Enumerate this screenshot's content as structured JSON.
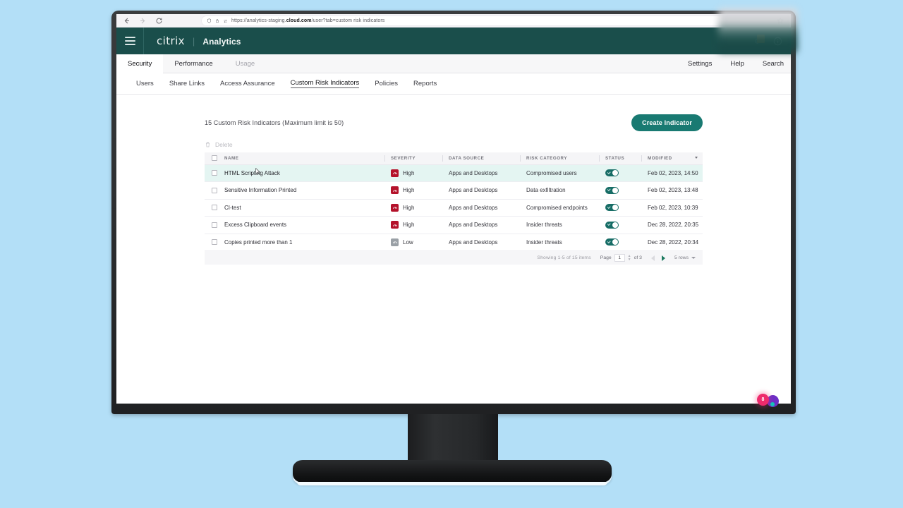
{
  "browser": {
    "url_prefix": "https://analytics-staging.",
    "url_domain": "cloud.com",
    "url_suffix": "/user?tab=custom risk indicators",
    "back_icon": "back-arrow-icon",
    "forward_icon": "forward-arrow-icon",
    "reload_icon": "reload-icon",
    "shield_icon": "shield-icon",
    "lock_icon": "lock-icon",
    "tracking_icon": "tracking-prevention-icon",
    "favorite_icon": "star-icon"
  },
  "app_header": {
    "menu_icon": "hamburger-menu-icon",
    "brand": "citrix",
    "separator": "|",
    "product": "Analytics",
    "notification_icon": "bell-icon",
    "help_icon": "info-circle-icon"
  },
  "primary_tabs": [
    {
      "label": "Security",
      "active": true,
      "muted": false
    },
    {
      "label": "Performance",
      "active": false,
      "muted": false
    },
    {
      "label": "Usage",
      "active": false,
      "muted": true
    }
  ],
  "primary_right": [
    {
      "label": "Settings"
    },
    {
      "label": "Help"
    },
    {
      "label": "Search"
    }
  ],
  "secondary_tabs": [
    {
      "label": "Users",
      "active": false
    },
    {
      "label": "Share Links",
      "active": false
    },
    {
      "label": "Access Assurance",
      "active": false
    },
    {
      "label": "Custom Risk Indicators",
      "active": true
    },
    {
      "label": "Policies",
      "active": false
    },
    {
      "label": "Reports",
      "active": false
    }
  ],
  "main": {
    "count_text": "15 Custom Risk Indicators (Maximum limit is 50)",
    "create_button": "Create Indicator",
    "delete_label": "Delete",
    "delete_icon": "trash-icon"
  },
  "table": {
    "columns": [
      "NAME",
      "SEVERITY",
      "DATA SOURCE",
      "RISK CATEGORY",
      "STATUS",
      "MODIFIED"
    ],
    "rows": [
      {
        "name": "HTML Scripting Attack",
        "severity": "High",
        "severity_level": "high",
        "data_source": "Apps and Desktops",
        "risk_category": "Compromised users",
        "status_on": true,
        "modified": "Feb 02, 2023, 14:50",
        "highlighted": true
      },
      {
        "name": "Sensitive Information Printed",
        "severity": "High",
        "severity_level": "high",
        "data_source": "Apps and Desktops",
        "risk_category": "Data exfiltration",
        "status_on": true,
        "modified": "Feb 02, 2023, 13:48",
        "highlighted": false
      },
      {
        "name": "CI-test",
        "severity": "High",
        "severity_level": "high",
        "data_source": "Apps and Desktops",
        "risk_category": "Compromised endpoints",
        "status_on": true,
        "modified": "Feb 02, 2023, 10:39",
        "highlighted": false
      },
      {
        "name": "Excess Clipboard events",
        "severity": "High",
        "severity_level": "high",
        "data_source": "Apps and Desktops",
        "risk_category": "Insider threats",
        "status_on": true,
        "modified": "Dec 28, 2022, 20:35",
        "highlighted": false
      },
      {
        "name": "Copies printed more than 1",
        "severity": "Low",
        "severity_level": "low",
        "data_source": "Apps and Desktops",
        "risk_category": "Insider threats",
        "status_on": true,
        "modified": "Dec 28, 2022, 20:34",
        "highlighted": false
      }
    ]
  },
  "pagination": {
    "showing": "Showing 1-5 of 15 items",
    "page_label": "Page",
    "page_value": "1",
    "of_label": "of 3",
    "prev_icon": "previous-page-icon",
    "next_icon": "next-page-icon",
    "rows_per_page": "5 rows",
    "rows_chevron": "chevron-down-icon"
  },
  "overlay": {
    "badge_pink": "8",
    "badge_purple": ""
  },
  "colors": {
    "brand_teal": "#1a4e4b",
    "accent_green": "#197a72",
    "severity_high": "#b4122b",
    "severity_low": "#9aa0a6",
    "toggle_on": "#176d66",
    "row_highlight": "#e4f5f2",
    "page_background": "#b3dff7"
  }
}
